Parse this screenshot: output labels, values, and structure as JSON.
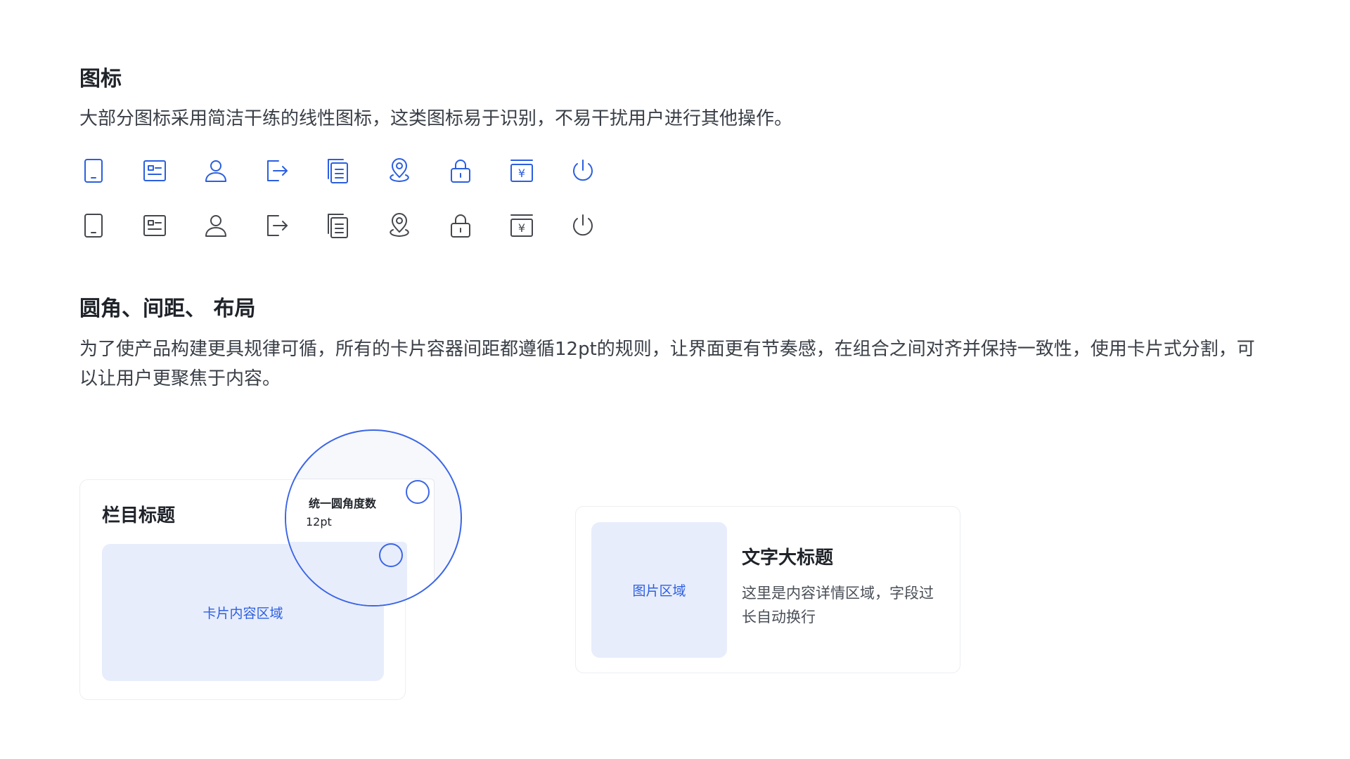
{
  "icons_section": {
    "title": "图标",
    "description": "大部分图标采用简洁干练的线性图标，这类图标易于识别，不易干扰用户进行其他操作。",
    "icons": [
      "tablet-icon",
      "id-card-icon",
      "user-icon",
      "logout-icon",
      "document-icon",
      "location-icon",
      "lock-icon",
      "payment-icon",
      "power-icon"
    ],
    "rows": [
      {
        "name": "blue",
        "color": "#2b5fe0"
      },
      {
        "name": "gray",
        "color": "#44474d"
      }
    ],
    "payment_symbol": "¥"
  },
  "layout_section": {
    "title": "圆角、间距、 布局",
    "description": "为了使产品构建更具规律可循，所有的卡片容器间距都遵循12pt的规则，让界面更有节奏感，在组合之间对齐并保持一致性，使用卡片式分割，可以让用户更聚焦于内容。"
  },
  "card_example_1": {
    "title": "栏目标题",
    "content_label": "卡片内容区域"
  },
  "magnifier": {
    "label_line1": "统一圆角度数",
    "label_line2": "12pt"
  },
  "card_example_2": {
    "image_label": "图片区域",
    "title": "文字大标题",
    "body": "这里是内容详情区域，字段过长自动换行"
  },
  "colors": {
    "accent": "#2b5fe0",
    "card_fill": "#e8edfc",
    "text_primary": "#1f2329"
  }
}
